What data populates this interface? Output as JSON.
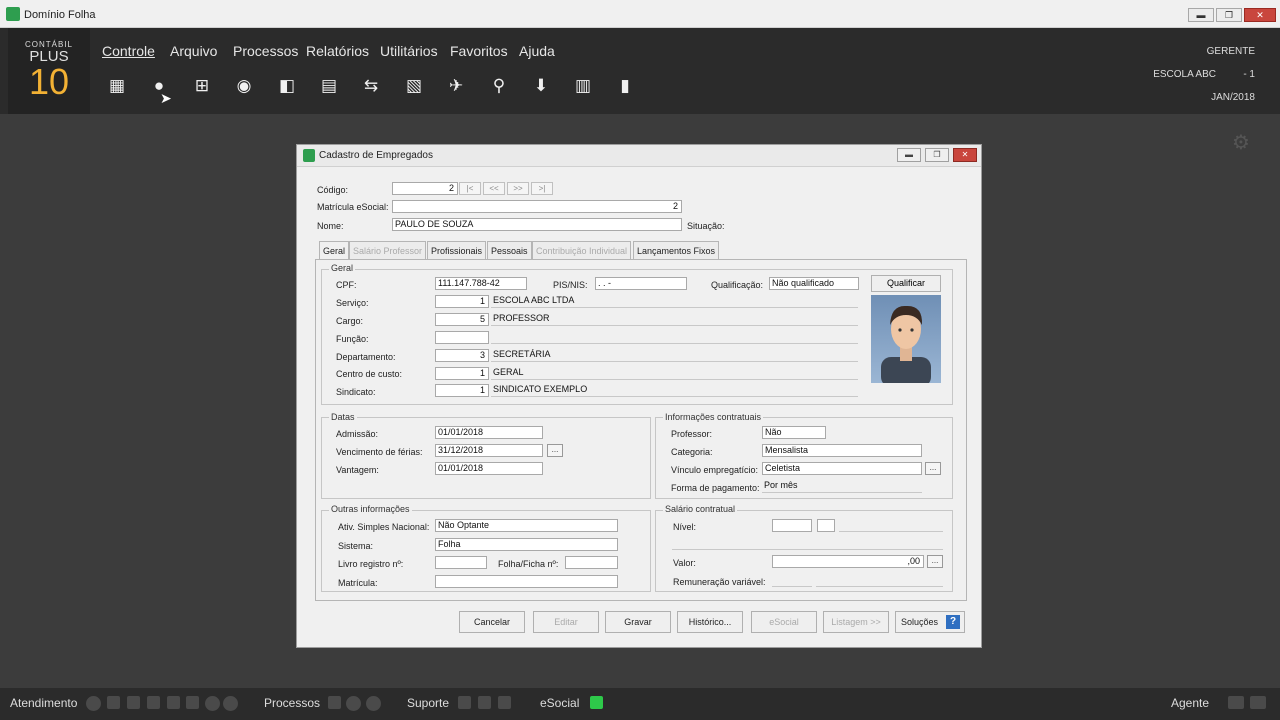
{
  "os_window": {
    "title": "Domínio Folha",
    "min": "▬",
    "max": "❐",
    "close": "✕"
  },
  "logo": {
    "line1": "CONTÁBIL",
    "line2": "PLUS",
    "line3": "10"
  },
  "menu": [
    "Controle",
    "Arquivo",
    "Processos",
    "Relatórios",
    "Utilitários",
    "Favoritos",
    "Ajuda"
  ],
  "toolbar_icons": [
    "building-icon",
    "employee-icon",
    "org-chart-icon",
    "user-search-icon",
    "export-icon",
    "calculator-list-icon",
    "transfer-icon",
    "invoice-icon",
    "airplane-icon",
    "search-icon",
    "download-icon",
    "calculator-icon",
    "book-icon"
  ],
  "header_right": {
    "user": "GERENTE",
    "company": "ESCOLA ABC",
    "company_code": "- 1",
    "period": "JAN/2018"
  },
  "dialog": {
    "title": "Cadastro de Empregados",
    "codigo_label": "Código:",
    "codigo": "2",
    "nav": [
      "|<",
      "<<",
      ">>",
      ">|"
    ],
    "matricula_esocial_label": "Matrícula eSocial:",
    "matricula_esocial": "2",
    "nome_label": "Nome:",
    "nome": "PAULO DE SOUZA",
    "situacao_label": "Situação:",
    "tabs": [
      {
        "label": "Geral",
        "state": "active"
      },
      {
        "label": "Salário Professor",
        "state": "disabled"
      },
      {
        "label": "Profissionais",
        "state": "normal"
      },
      {
        "label": "Pessoais",
        "state": "normal"
      },
      {
        "label": "Contribuição Individual",
        "state": "disabled"
      },
      {
        "label": "Lançamentos Fixos",
        "state": "normal"
      }
    ],
    "geral": {
      "title": "Geral",
      "cpf_label": "CPF:",
      "cpf": "111.147.788-42",
      "pis_label": "PIS/NIS:",
      "pis": ".    .    -",
      "qualificacao_label": "Qualificação:",
      "qualificacao": "Não qualificado",
      "qualificar_button": "Qualificar",
      "rows": [
        {
          "label": "Serviço:",
          "code": "1",
          "desc": "ESCOLA ABC LTDA"
        },
        {
          "label": "Cargo:",
          "code": "5",
          "desc": "PROFESSOR"
        },
        {
          "label": "Função:",
          "code": "",
          "desc": ""
        },
        {
          "label": "Departamento:",
          "code": "3",
          "desc": "SECRETÁRIA"
        },
        {
          "label": "Centro de custo:",
          "code": "1",
          "desc": "GERAL"
        },
        {
          "label": "Sindicato:",
          "code": "1",
          "desc": "SINDICATO EXEMPLO"
        }
      ]
    },
    "datas": {
      "title": "Datas",
      "admissao_label": "Admissão:",
      "admissao": "01/01/2018",
      "vencimento_label": "Vencimento de férias:",
      "vencimento": "31/12/2018",
      "vantagem_label": "Vantagem:",
      "vantagem": "01/01/2018",
      "ellipsis": "..."
    },
    "contratuais": {
      "title": "Informações contratuais",
      "professor_label": "Professor:",
      "professor": "Não",
      "categoria_label": "Categoria:",
      "categoria": "Mensalista",
      "vinculo_label": "Vínculo empregatício:",
      "vinculo": "Celetista",
      "pagamento_label": "Forma de pagamento:",
      "pagamento": "Por mês"
    },
    "outras": {
      "title": "Outras informações",
      "simples_label": "Ativ. Simples Nacional:",
      "simples": "Não Optante",
      "sistema_label": "Sistema:",
      "sistema": "Folha",
      "livro_label": "Livro registro nº:",
      "livro": "",
      "folha_label": "Folha/Ficha nº:",
      "folha": "",
      "matricula_label": "Matrícula:",
      "matricula": ""
    },
    "salario": {
      "title": "Salário contratual",
      "nivel_label": "Nível:",
      "valor_label": "Valor:",
      "valor": ",00",
      "remuneracao_label": "Remuneração variável:"
    },
    "buttons": [
      {
        "label": "Cancelar",
        "state": "normal"
      },
      {
        "label": "Editar",
        "state": "disabled"
      },
      {
        "label": "Gravar",
        "state": "normal"
      },
      {
        "label": "Histórico...",
        "state": "normal"
      },
      {
        "label": "eSocial",
        "state": "disabled"
      },
      {
        "label": "Listagem >>",
        "state": "disabled"
      }
    ],
    "solucoes_label": "Soluções",
    "help": "?"
  },
  "status_bar": {
    "atendimento": "Atendimento",
    "processos": "Processos",
    "suporte": "Suporte",
    "esocial": "eSocial",
    "agente": "Agente"
  },
  "colors": {
    "header_bg": "#2b2b2b",
    "desktop_bg": "#3c3c3c",
    "accent_green": "#2e9e4f",
    "logo_orange": "#f2b134",
    "close_red": "#c9463d"
  }
}
